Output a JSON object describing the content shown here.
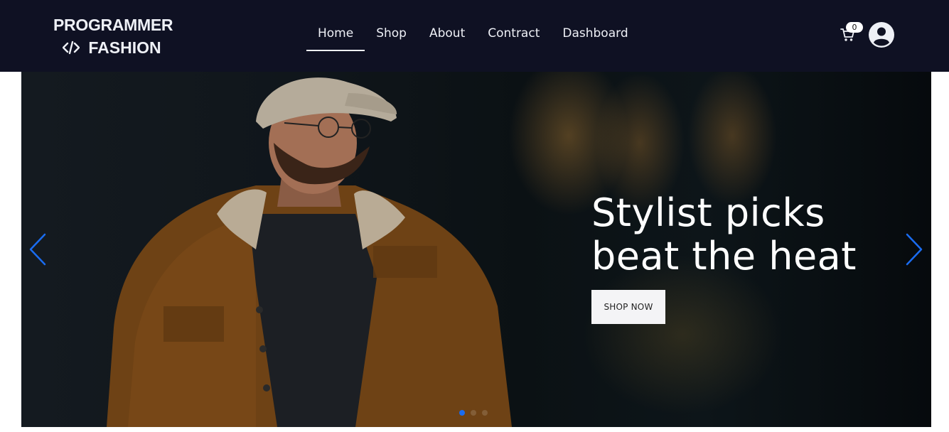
{
  "brand": {
    "line1": "PROGRAMMER",
    "line2": "FASHION",
    "icon": "code-icon"
  },
  "nav": {
    "items": [
      {
        "label": "Home",
        "active": true
      },
      {
        "label": "Shop",
        "active": false
      },
      {
        "label": "About",
        "active": false
      },
      {
        "label": "Contract",
        "active": false
      },
      {
        "label": "Dashboard",
        "active": false
      }
    ]
  },
  "cart": {
    "icon": "cart-icon",
    "count": "0"
  },
  "user": {
    "icon": "user-avatar-icon"
  },
  "hero": {
    "title_line1": "Stylist picks",
    "title_line2": "beat the heat",
    "cta_label": "SHOP NOW",
    "prev_icon": "chevron-left-icon",
    "next_icon": "chevron-right-icon",
    "slide_count": 3,
    "active_slide": 1
  },
  "colors": {
    "navbar_bg": "#0f1123",
    "nav_text": "#eef0f6",
    "arrow_accent": "#1a6cf0",
    "button_bg": "#f4f4f6"
  }
}
